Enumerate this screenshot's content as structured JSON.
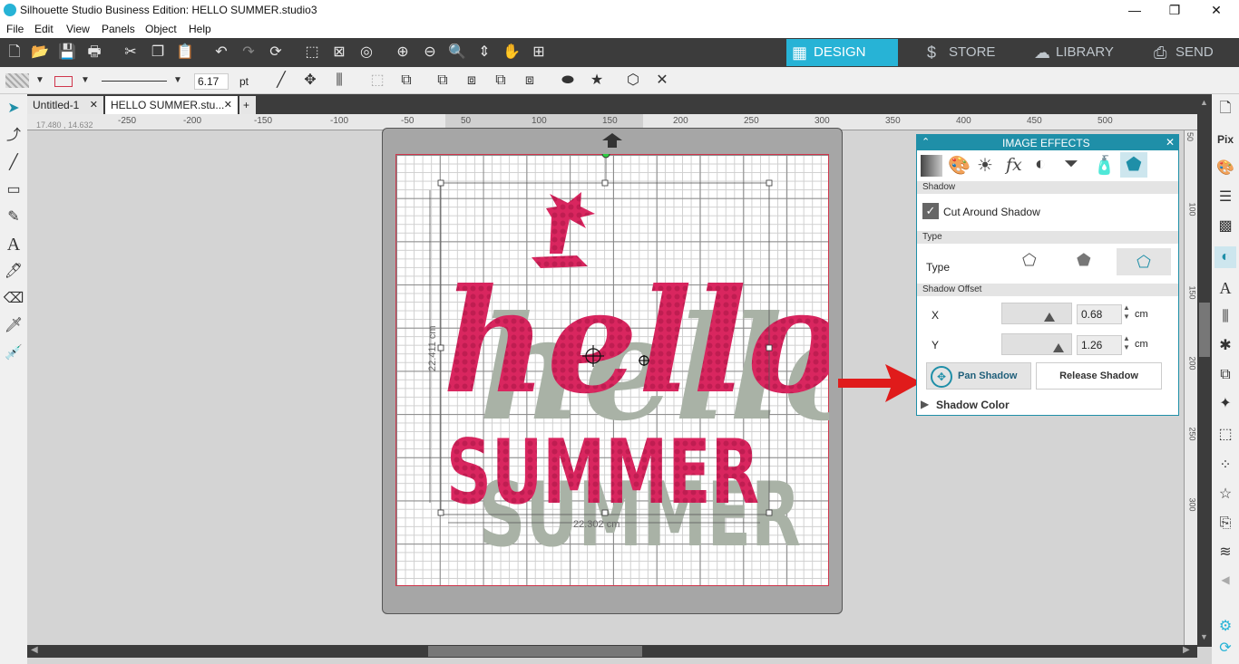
{
  "window": {
    "title": "Silhouette Studio Business Edition: HELLO SUMMER.studio3",
    "minimize": "—",
    "maximize": "❐",
    "close": "✕"
  },
  "menu": [
    "File",
    "Edit",
    "View",
    "Panels",
    "Object",
    "Help"
  ],
  "nav_tabs": {
    "design": "DESIGN",
    "store": "STORE",
    "library": "LIBRARY",
    "send": "SEND"
  },
  "toolbar2": {
    "line_width_value": "6.17",
    "line_width_unit": "pt"
  },
  "doc_tabs": [
    {
      "label": "Untitled-1",
      "close": "✕"
    },
    {
      "label": "HELLO SUMMER.stu...",
      "close": "✕"
    }
  ],
  "add_tab": "+",
  "coords": "17.480 , 14.632",
  "ruler_top": [
    "-250",
    "-200",
    "-150",
    "-100",
    "-50",
    "50",
    "100",
    "150",
    "200",
    "250",
    "300",
    "350",
    "400",
    "450",
    "500"
  ],
  "ruler_right": [
    "50",
    "100",
    "150",
    "200",
    "250",
    "300"
  ],
  "canvas": {
    "height_label": "22.411 cm",
    "width_label": "22.302 cm",
    "design_line1": "hello",
    "design_line2": "SUMMER"
  },
  "image_effects": {
    "title": "IMAGE EFFECTS",
    "section_shadow": "Shadow",
    "cut_around_shadow": "Cut Around Shadow",
    "section_type": "Type",
    "type_label": "Type",
    "section_offset": "Shadow Offset",
    "x_label": "X",
    "x_value": "0.68",
    "x_unit": "cm",
    "y_label": "Y",
    "y_value": "1.26",
    "y_unit": "cm",
    "pan_shadow": "Pan Shadow",
    "release_shadow": "Release Shadow",
    "shadow_color": "Shadow Color"
  },
  "colors": {
    "accent": "#27b3d6",
    "panel_header": "#1f8fa8",
    "design_pink": "#d9265f",
    "shadow_gray": "#a9b2a6",
    "arrow_red": "#e01b1b"
  }
}
